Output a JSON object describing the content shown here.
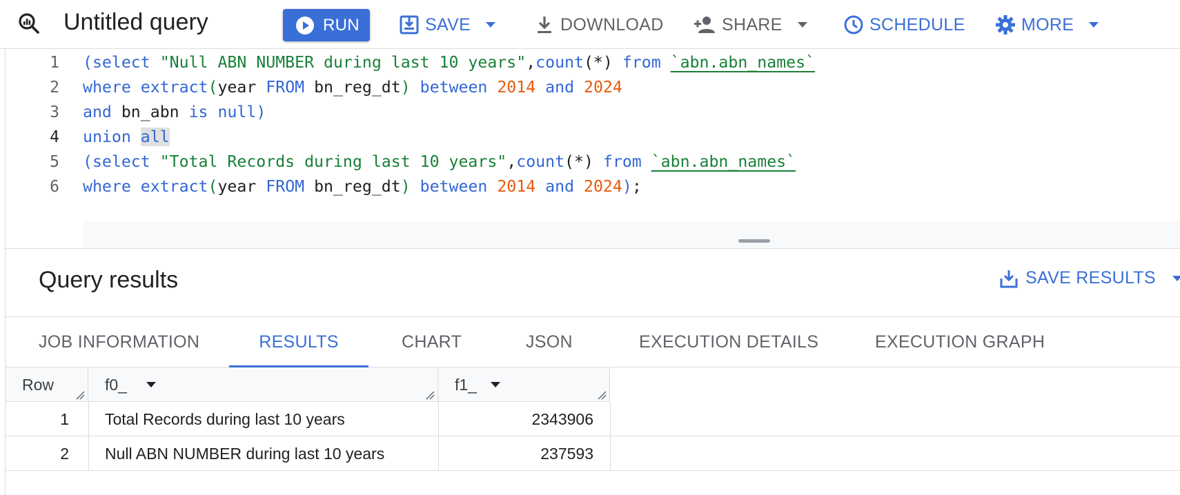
{
  "toolbar": {
    "title": "Untitled query",
    "run_label": "RUN",
    "save_label": "SAVE",
    "download_label": "DOWNLOAD",
    "share_label": "SHARE",
    "schedule_label": "SCHEDULE",
    "more_label": "MORE"
  },
  "editor": {
    "active_line": 4,
    "lines": [
      {
        "num": "1"
      },
      {
        "num": "2"
      },
      {
        "num": "3"
      },
      {
        "num": "4"
      },
      {
        "num": "5"
      },
      {
        "num": "6"
      }
    ],
    "tokens": {
      "l1": {
        "open": "(",
        "select": "select",
        "str": " \"Null ABN NUMBER during last 10 years\"",
        "comma": ",",
        "count": "count",
        "star": "(*)",
        "from": " from ",
        "table": "`abn.abn_names`"
      },
      "l2": {
        "where": "where",
        "extract": " extract",
        "paren_open": "(",
        "year": "year ",
        "from_kw": "FROM",
        "col": " bn_reg_dt",
        "paren_close": ")",
        "between": " between ",
        "n1": "2014",
        "and": " and ",
        "n2": "2024"
      },
      "l3": {
        "and": "and",
        "col": " bn_abn ",
        "is": "is",
        "null": " null",
        "close": ")"
      },
      "l4": {
        "union": "union ",
        "all": "all"
      },
      "l5": {
        "open": "(",
        "select": "select",
        "str": " \"Total Records during last 10 years\"",
        "comma": ",",
        "count": "count",
        "star": "(*)",
        "from": " from ",
        "table": "`abn.abn_names`"
      },
      "l6": {
        "where": "where",
        "extract": " extract",
        "paren_open": "(",
        "year": "year ",
        "from_kw": "FROM",
        "col": " bn_reg_dt",
        "paren_close": ")",
        "between": " between ",
        "n1": "2014",
        "and": " and ",
        "n2": "2024",
        "close": ")",
        "semi": ";"
      }
    }
  },
  "results": {
    "title": "Query results",
    "save_results_label": "SAVE RESULTS",
    "tabs": [
      {
        "label": "JOB INFORMATION"
      },
      {
        "label": "RESULTS"
      },
      {
        "label": "CHART"
      },
      {
        "label": "JSON"
      },
      {
        "label": "EXECUTION DETAILS"
      },
      {
        "label": "EXECUTION GRAPH"
      }
    ],
    "active_tab": "RESULTS",
    "columns": [
      "Row",
      "f0_",
      "f1_"
    ],
    "rows": [
      {
        "row": "1",
        "f0": "Total Records during last 10 years",
        "f1": "2343906"
      },
      {
        "row": "2",
        "f0": "Null ABN NUMBER during last 10 years",
        "f1": "237593"
      }
    ]
  },
  "colors": {
    "accent": "#3a6fd8",
    "keyword": "#3367d6",
    "string": "#188038",
    "number": "#e8590c"
  }
}
